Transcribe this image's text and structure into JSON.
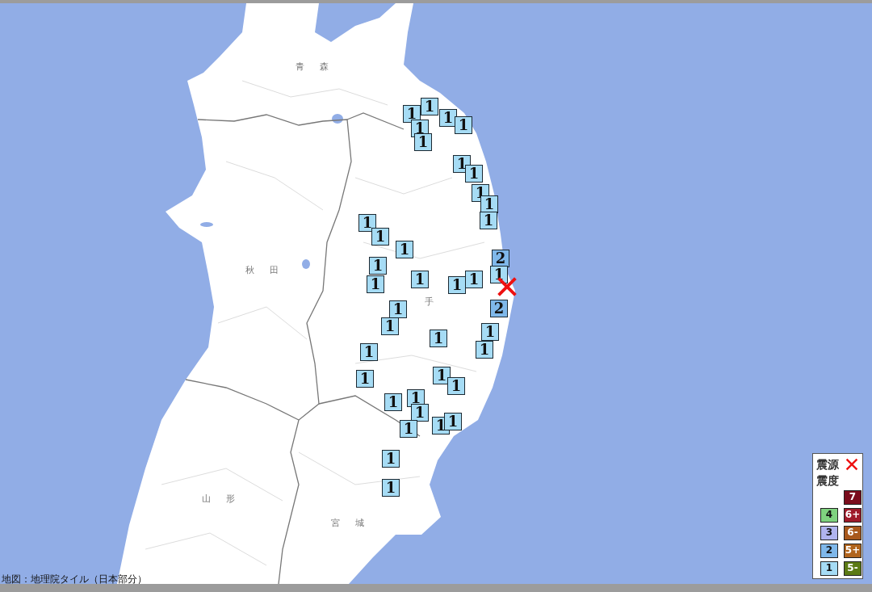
{
  "map": {
    "prefecture_labels": [
      "青 森",
      "秋 田",
      "手",
      "山 形",
      "宮 城"
    ]
  },
  "stations": [
    {
      "intensity": "1",
      "color": "#a6dcf5"
    },
    {
      "intensity": "1",
      "color": "#a6dcf5"
    },
    {
      "intensity": "1",
      "color": "#a6dcf5"
    },
    {
      "intensity": "1",
      "color": "#a6dcf5"
    },
    {
      "intensity": "1",
      "color": "#a6dcf5"
    },
    {
      "intensity": "1",
      "color": "#a6dcf5"
    },
    {
      "intensity": "1",
      "color": "#a6dcf5"
    },
    {
      "intensity": "1",
      "color": "#a6dcf5"
    },
    {
      "intensity": "1",
      "color": "#a6dcf5"
    },
    {
      "intensity": "1",
      "color": "#a6dcf5"
    },
    {
      "intensity": "1",
      "color": "#a6dcf5"
    },
    {
      "intensity": "1",
      "color": "#a6dcf5"
    },
    {
      "intensity": "1",
      "color": "#a6dcf5"
    },
    {
      "intensity": "1",
      "color": "#a6dcf5"
    },
    {
      "intensity": "1",
      "color": "#a6dcf5"
    },
    {
      "intensity": "2",
      "color": "#7fb8ea"
    },
    {
      "intensity": "1",
      "color": "#a6dcf5"
    },
    {
      "intensity": "1",
      "color": "#a6dcf5"
    },
    {
      "intensity": "1",
      "color": "#a6dcf5"
    },
    {
      "intensity": "1",
      "color": "#a6dcf5"
    },
    {
      "intensity": "1",
      "color": "#a6dcf5"
    },
    {
      "intensity": "1",
      "color": "#a6dcf5"
    },
    {
      "intensity": "2",
      "color": "#7fb8ea"
    },
    {
      "intensity": "1",
      "color": "#a6dcf5"
    },
    {
      "intensity": "1",
      "color": "#a6dcf5"
    },
    {
      "intensity": "1",
      "color": "#a6dcf5"
    },
    {
      "intensity": "1",
      "color": "#a6dcf5"
    },
    {
      "intensity": "1",
      "color": "#a6dcf5"
    },
    {
      "intensity": "1",
      "color": "#a6dcf5"
    },
    {
      "intensity": "1",
      "color": "#a6dcf5"
    },
    {
      "intensity": "1",
      "color": "#a6dcf5"
    },
    {
      "intensity": "1",
      "color": "#a6dcf5"
    },
    {
      "intensity": "1",
      "color": "#a6dcf5"
    },
    {
      "intensity": "1",
      "color": "#a6dcf5"
    },
    {
      "intensity": "1",
      "color": "#a6dcf5"
    },
    {
      "intensity": "1",
      "color": "#a6dcf5"
    },
    {
      "intensity": "1",
      "color": "#a6dcf5"
    },
    {
      "intensity": "1",
      "color": "#a6dcf5"
    },
    {
      "intensity": "1",
      "color": "#a6dcf5"
    }
  ],
  "legend": {
    "epicenter_label": "震源",
    "intensity_label": "震度",
    "left_column": [
      {
        "label": "4",
        "color": "#7fd27f"
      },
      {
        "label": "3",
        "color": "#b0b4ee"
      },
      {
        "label": "2",
        "color": "#7fb8ea"
      },
      {
        "label": "1",
        "color": "#a6dcf5"
      }
    ],
    "right_column": [
      {
        "label": "7",
        "color": "#7a0c1c"
      },
      {
        "label": "6+",
        "color": "#9e1a2a"
      },
      {
        "label": "6-",
        "color": "#a8581c"
      },
      {
        "label": "5+",
        "color": "#b0641c"
      },
      {
        "label": "5-",
        "color": "#5c7a14"
      }
    ]
  },
  "attribution": "地図：地理院タイル（日本部分）"
}
